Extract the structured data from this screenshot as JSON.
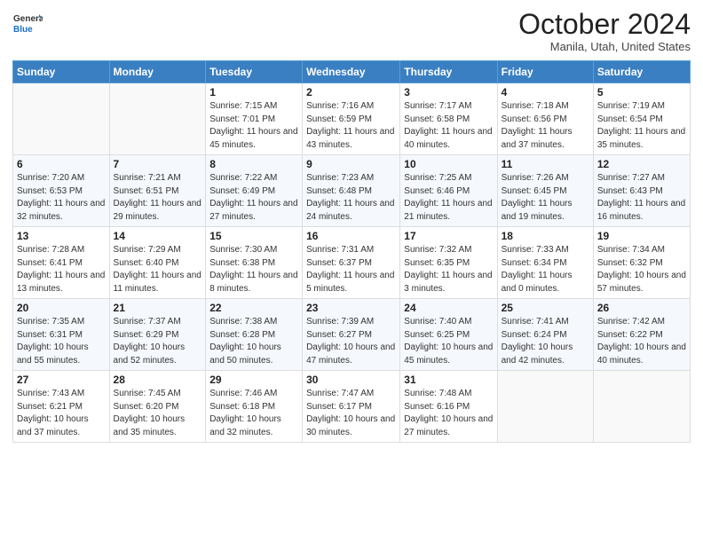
{
  "header": {
    "logo_general": "General",
    "logo_blue": "Blue",
    "month_title": "October 2024",
    "location": "Manila, Utah, United States"
  },
  "days_of_week": [
    "Sunday",
    "Monday",
    "Tuesday",
    "Wednesday",
    "Thursday",
    "Friday",
    "Saturday"
  ],
  "weeks": [
    [
      {
        "num": "",
        "info": ""
      },
      {
        "num": "",
        "info": ""
      },
      {
        "num": "1",
        "info": "Sunrise: 7:15 AM\nSunset: 7:01 PM\nDaylight: 11 hours and 45 minutes."
      },
      {
        "num": "2",
        "info": "Sunrise: 7:16 AM\nSunset: 6:59 PM\nDaylight: 11 hours and 43 minutes."
      },
      {
        "num": "3",
        "info": "Sunrise: 7:17 AM\nSunset: 6:58 PM\nDaylight: 11 hours and 40 minutes."
      },
      {
        "num": "4",
        "info": "Sunrise: 7:18 AM\nSunset: 6:56 PM\nDaylight: 11 hours and 37 minutes."
      },
      {
        "num": "5",
        "info": "Sunrise: 7:19 AM\nSunset: 6:54 PM\nDaylight: 11 hours and 35 minutes."
      }
    ],
    [
      {
        "num": "6",
        "info": "Sunrise: 7:20 AM\nSunset: 6:53 PM\nDaylight: 11 hours and 32 minutes."
      },
      {
        "num": "7",
        "info": "Sunrise: 7:21 AM\nSunset: 6:51 PM\nDaylight: 11 hours and 29 minutes."
      },
      {
        "num": "8",
        "info": "Sunrise: 7:22 AM\nSunset: 6:49 PM\nDaylight: 11 hours and 27 minutes."
      },
      {
        "num": "9",
        "info": "Sunrise: 7:23 AM\nSunset: 6:48 PM\nDaylight: 11 hours and 24 minutes."
      },
      {
        "num": "10",
        "info": "Sunrise: 7:25 AM\nSunset: 6:46 PM\nDaylight: 11 hours and 21 minutes."
      },
      {
        "num": "11",
        "info": "Sunrise: 7:26 AM\nSunset: 6:45 PM\nDaylight: 11 hours and 19 minutes."
      },
      {
        "num": "12",
        "info": "Sunrise: 7:27 AM\nSunset: 6:43 PM\nDaylight: 11 hours and 16 minutes."
      }
    ],
    [
      {
        "num": "13",
        "info": "Sunrise: 7:28 AM\nSunset: 6:41 PM\nDaylight: 11 hours and 13 minutes."
      },
      {
        "num": "14",
        "info": "Sunrise: 7:29 AM\nSunset: 6:40 PM\nDaylight: 11 hours and 11 minutes."
      },
      {
        "num": "15",
        "info": "Sunrise: 7:30 AM\nSunset: 6:38 PM\nDaylight: 11 hours and 8 minutes."
      },
      {
        "num": "16",
        "info": "Sunrise: 7:31 AM\nSunset: 6:37 PM\nDaylight: 11 hours and 5 minutes."
      },
      {
        "num": "17",
        "info": "Sunrise: 7:32 AM\nSunset: 6:35 PM\nDaylight: 11 hours and 3 minutes."
      },
      {
        "num": "18",
        "info": "Sunrise: 7:33 AM\nSunset: 6:34 PM\nDaylight: 11 hours and 0 minutes."
      },
      {
        "num": "19",
        "info": "Sunrise: 7:34 AM\nSunset: 6:32 PM\nDaylight: 10 hours and 57 minutes."
      }
    ],
    [
      {
        "num": "20",
        "info": "Sunrise: 7:35 AM\nSunset: 6:31 PM\nDaylight: 10 hours and 55 minutes."
      },
      {
        "num": "21",
        "info": "Sunrise: 7:37 AM\nSunset: 6:29 PM\nDaylight: 10 hours and 52 minutes."
      },
      {
        "num": "22",
        "info": "Sunrise: 7:38 AM\nSunset: 6:28 PM\nDaylight: 10 hours and 50 minutes."
      },
      {
        "num": "23",
        "info": "Sunrise: 7:39 AM\nSunset: 6:27 PM\nDaylight: 10 hours and 47 minutes."
      },
      {
        "num": "24",
        "info": "Sunrise: 7:40 AM\nSunset: 6:25 PM\nDaylight: 10 hours and 45 minutes."
      },
      {
        "num": "25",
        "info": "Sunrise: 7:41 AM\nSunset: 6:24 PM\nDaylight: 10 hours and 42 minutes."
      },
      {
        "num": "26",
        "info": "Sunrise: 7:42 AM\nSunset: 6:22 PM\nDaylight: 10 hours and 40 minutes."
      }
    ],
    [
      {
        "num": "27",
        "info": "Sunrise: 7:43 AM\nSunset: 6:21 PM\nDaylight: 10 hours and 37 minutes."
      },
      {
        "num": "28",
        "info": "Sunrise: 7:45 AM\nSunset: 6:20 PM\nDaylight: 10 hours and 35 minutes."
      },
      {
        "num": "29",
        "info": "Sunrise: 7:46 AM\nSunset: 6:18 PM\nDaylight: 10 hours and 32 minutes."
      },
      {
        "num": "30",
        "info": "Sunrise: 7:47 AM\nSunset: 6:17 PM\nDaylight: 10 hours and 30 minutes."
      },
      {
        "num": "31",
        "info": "Sunrise: 7:48 AM\nSunset: 6:16 PM\nDaylight: 10 hours and 27 minutes."
      },
      {
        "num": "",
        "info": ""
      },
      {
        "num": "",
        "info": ""
      }
    ]
  ]
}
